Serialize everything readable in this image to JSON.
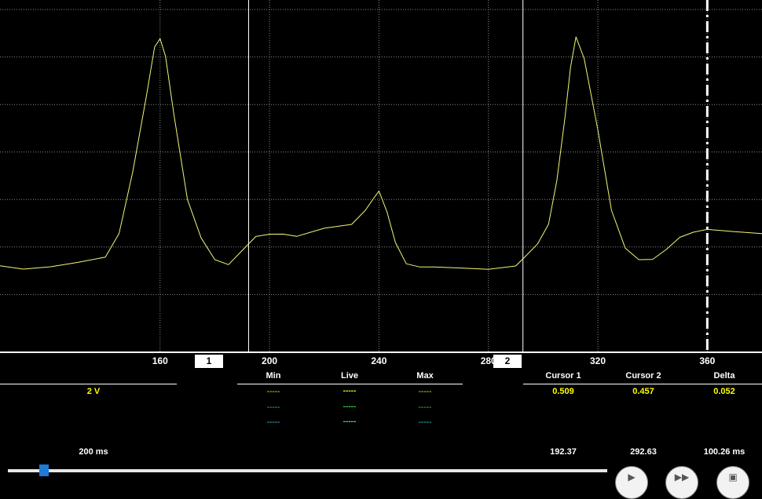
{
  "colors": {
    "background": "#000000",
    "trace": "#f5f579",
    "channel_yellow": "#ffff00",
    "channel_green": "#33dd33",
    "channel_cyan": "#33ddee",
    "grid": "#8a8a8a",
    "axis": "#ffffff",
    "slider_thumb": "#1e7bd6"
  },
  "chart_data": {
    "type": "line",
    "title": "",
    "xlabel": "",
    "ylabel": "",
    "xlim": [
      101.5,
      380
    ],
    "ylim": [
      -1.2,
      6.2
    ],
    "grid": true,
    "x_ticks": [
      "160",
      "200",
      "240",
      "280",
      "320",
      "360"
    ],
    "x_tick_values": [
      160,
      200,
      240,
      280,
      320,
      360
    ],
    "series": [
      {
        "values_x": [
          101.5,
          110,
          120,
          130,
          140,
          145,
          150,
          155,
          158,
          160,
          162,
          165,
          170,
          175,
          180,
          185,
          190,
          195,
          200,
          205,
          210,
          220,
          230,
          235,
          238,
          240,
          243,
          246,
          250,
          255,
          260,
          270,
          280,
          290,
          293,
          298,
          302,
          305,
          308,
          310,
          312,
          315,
          320,
          325,
          330,
          335,
          340,
          345,
          350,
          355,
          360,
          370,
          380
        ],
        "values_y": [
          0.58,
          0.56,
          0.57,
          0.65,
          0.8,
          1.3,
          2.6,
          4.2,
          5.2,
          5.4,
          5.0,
          3.8,
          2.0,
          1.2,
          0.75,
          0.65,
          0.95,
          1.25,
          1.3,
          1.3,
          1.25,
          1.38,
          1.45,
          1.75,
          2.05,
          2.15,
          1.75,
          1.1,
          0.62,
          0.55,
          0.55,
          0.56,
          0.56,
          0.6,
          0.75,
          1.05,
          1.5,
          2.4,
          3.7,
          4.8,
          5.4,
          5.0,
          3.5,
          1.8,
          1.0,
          0.75,
          0.75,
          0.95,
          1.2,
          1.3,
          1.35,
          1.3,
          1.3
        ]
      }
    ],
    "cursors": [
      {
        "label": "1",
        "x": 192.37
      },
      {
        "label": "2",
        "x": 292.63
      }
    ],
    "trigger_marker_x": 360
  },
  "readouts": {
    "voltage_scale": "2 V",
    "timebase": "200 ms",
    "columns": {
      "min": "Min",
      "live": "Live",
      "max": "Max"
    },
    "channel_rows": [
      {
        "min": "-----",
        "live": "-----",
        "max": "-----"
      },
      {
        "min": "-----",
        "live": "-----",
        "max": "-----"
      },
      {
        "min": "-----",
        "live": "-----",
        "max": "-----"
      }
    ],
    "cursor_headers": {
      "c1": "Cursor 1",
      "c2": "Cursor 2",
      "delta": "Delta"
    },
    "cursor_values": {
      "c1": "0.509",
      "c2": "0.457",
      "delta": "0.052"
    },
    "cursor_times": {
      "c1": "192.37",
      "c2": "292.63",
      "delta": "100.26 ms"
    }
  },
  "controls": {
    "slider_position_fraction": 0.06,
    "buttons": [
      {
        "icon": "play-icon"
      },
      {
        "icon": "fast-forward-icon"
      },
      {
        "icon": "screen-icon"
      }
    ]
  }
}
